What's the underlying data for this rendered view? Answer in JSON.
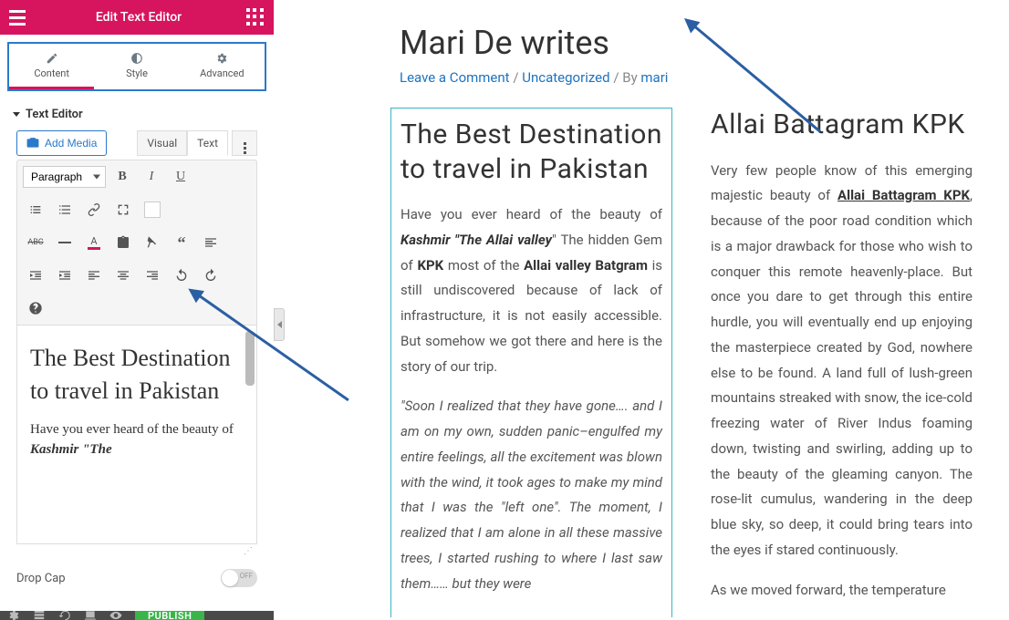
{
  "header": {
    "title": "Edit Text Editor"
  },
  "tabs": {
    "content": "Content",
    "style": "Style",
    "advanced": "Advanced"
  },
  "section": {
    "title": "Text Editor"
  },
  "editor": {
    "add_media": "Add Media",
    "mode_visual": "Visual",
    "mode_text": "Text",
    "format_select": "Paragraph",
    "content_heading": "The Best Destination to travel in Pakistan",
    "content_p_prefix": "Have you ever heard of the beauty of ",
    "content_p_em": "Kashmir \"The"
  },
  "dropcap": {
    "label": "Drop Cap",
    "state": "OFF"
  },
  "footer": {
    "publish": "PUBLISH"
  },
  "preview": {
    "title": "Mari De writes",
    "meta_comment": "Leave a Comment",
    "meta_cat": "Uncategorized",
    "meta_by": " / By ",
    "meta_author": "mari",
    "col1_heading": "The Best Destination to travel in Pakistan",
    "col1_p1_a": "Have you ever heard of the beauty of ",
    "col1_p1_b": "Kashmir \"The Allai valley",
    "col1_p1_c": "\" The hidden Gem of ",
    "col1_p1_d": "KPK",
    "col1_p1_e": " most of the ",
    "col1_p1_f": "Allai valley Batgram",
    "col1_p1_g": " is still undiscovered because of lack of infrastructure, it is not easily accessible. But somehow we got there and here is the story of our trip.",
    "col1_p2": "\"Soon I realized that they have gone…. and I am on my own, sudden panic–engulfed my entire feelings, all the excitement was blown with the wind, it took ages to make my mind that I was the \"left one\". The moment, I realized that I am alone in all these massive trees, I started rushing to where I last saw them…… but they were",
    "col2_heading": "Allai Battagram KPK",
    "col2_p1_a": "Very few people know of this emerging majestic beauty of ",
    "col2_p1_link": "Allai Battagram KPK",
    "col2_p1_b": ", because of the poor road condition which is a major drawback for those who wish to conquer this remote heavenly-place. But once you dare to get through this entire hurdle, you will eventually end up enjoying the masterpiece created by God, nowhere else to be found. A land full of lush-green mountains streaked with snow, the ice-cold freezing water of River Indus foaming down, twisting and swirling, adding up to the beauty of the gleaming canyon. The rose-lit cumulus, wandering in the deep blue sky, so deep, it could bring tears into the eyes if stared continuously.",
    "col2_p2": "  As we moved forward, the temperature"
  }
}
